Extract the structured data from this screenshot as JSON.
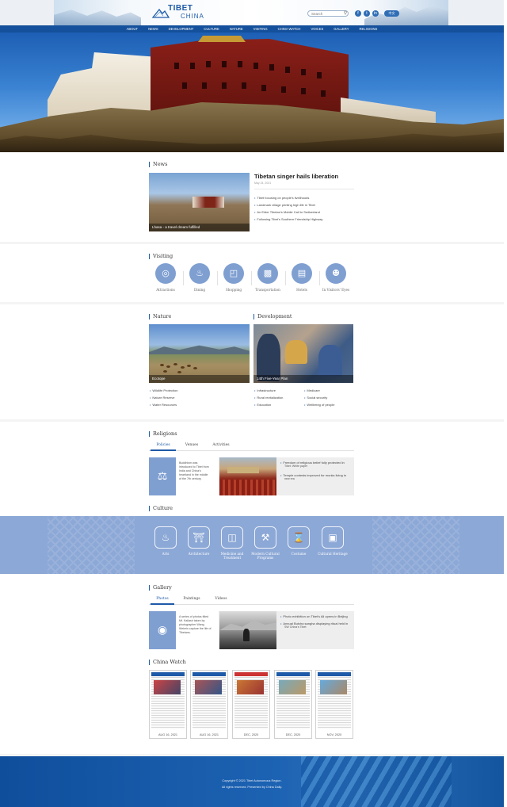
{
  "header": {
    "logo_line1": "TIBET",
    "logo_line2": "CHINA",
    "search_placeholder": "Search",
    "social": [
      "f",
      "t",
      "in"
    ],
    "language_label": "中文"
  },
  "nav": [
    "ABOUT",
    "NEWS",
    "DEVELOPMENT",
    "CULTURE",
    "NATURE",
    "VISITING",
    "CHINA WATCH",
    "VOICES",
    "GALLERY",
    "RELIGIONS"
  ],
  "news": {
    "title": "News",
    "image_caption": "Lhasa - a travel dream fulfilled",
    "headline": "Tibetan singer hails liberation",
    "date": "May 24, 2021",
    "items": [
      "Tibet focusing on people's livelihoods",
      "Landmark village printing high life in Tibet",
      "An Elder Tibetan's Mobile Call to Switzerland",
      "Following Tibet's Southern Friendship Highway"
    ]
  },
  "visiting": {
    "title": "Visiting",
    "items": [
      {
        "label": "Attractions",
        "icon": "camera-icon"
      },
      {
        "label": "Dining",
        "icon": "dining-icon"
      },
      {
        "label": "Shopping",
        "icon": "shopping-icon"
      },
      {
        "label": "Transportation",
        "icon": "transport-icon"
      },
      {
        "label": "Hotels",
        "icon": "hotel-icon"
      },
      {
        "label": "In Visitors' Eyes",
        "icon": "visitor-icon"
      }
    ]
  },
  "nature": {
    "title": "Nature",
    "image_caption": "Ecotope",
    "items": [
      "Wildlife Protection",
      "Nature Reserve",
      "Water Resources"
    ]
  },
  "development": {
    "title": "Development",
    "image_caption": "14th Five-Year Plan",
    "col1": [
      "Infrastructure",
      "Rural revitalization",
      "Education"
    ],
    "col2": [
      "Medicare",
      "Social security",
      "Wellbeing of people"
    ]
  },
  "religions": {
    "title": "Religions",
    "tabs": [
      "Policies",
      "Venues",
      "Activities"
    ],
    "card_text": [
      "Buddhism was",
      "introduced to Tibet from",
      "India and China's",
      "heartland in the middle",
      "of the 7th century."
    ],
    "items": [
      [
        "Freedom of religious belief fully protected in",
        "Tibet: White paper"
      ],
      [
        "Temple contests improved for monks living in",
        "new era"
      ]
    ]
  },
  "culture": {
    "title": "Culture",
    "items": [
      {
        "label": [
          "Arts"
        ],
        "icon": "arts-icon"
      },
      {
        "label": [
          "Architecture"
        ],
        "icon": "architecture-icon"
      },
      {
        "label": [
          "Medicine and",
          "Treatment"
        ],
        "icon": "medicine-icon"
      },
      {
        "label": [
          "Modern Cultural",
          "Programs"
        ],
        "icon": "programs-icon"
      },
      {
        "label": [
          "Costume"
        ],
        "icon": "costume-icon"
      },
      {
        "label": [
          "Cultural Heritage"
        ],
        "icon": "heritage-icon"
      }
    ]
  },
  "gallery": {
    "title": "Gallery",
    "tabs": [
      "Photos",
      "Paintings",
      "Videos"
    ],
    "card_text": [
      "A series of photos titled",
      "Mt. Kailash taken by",
      "photographer Wang",
      "Weimin capture the life of",
      "Tibetans."
    ],
    "items": [
      [
        "Photo exhibition on Tibet's Ali opens in Beijing"
      ],
      [
        "Annual Butcha sangha displaying ritual held in",
        "SW China's Tibet"
      ]
    ]
  },
  "china_watch": {
    "title": "China Watch",
    "papers": [
      "AUG 16, 2021",
      "AUG 16, 2021",
      "DEC, 2020",
      "DEC, 2020",
      "NOV, 2020"
    ]
  },
  "footer": {
    "line1": "Copyright © 2021 Tibet Autonomous Region.",
    "line2": "All rights reserved. Presented by China Daily."
  }
}
